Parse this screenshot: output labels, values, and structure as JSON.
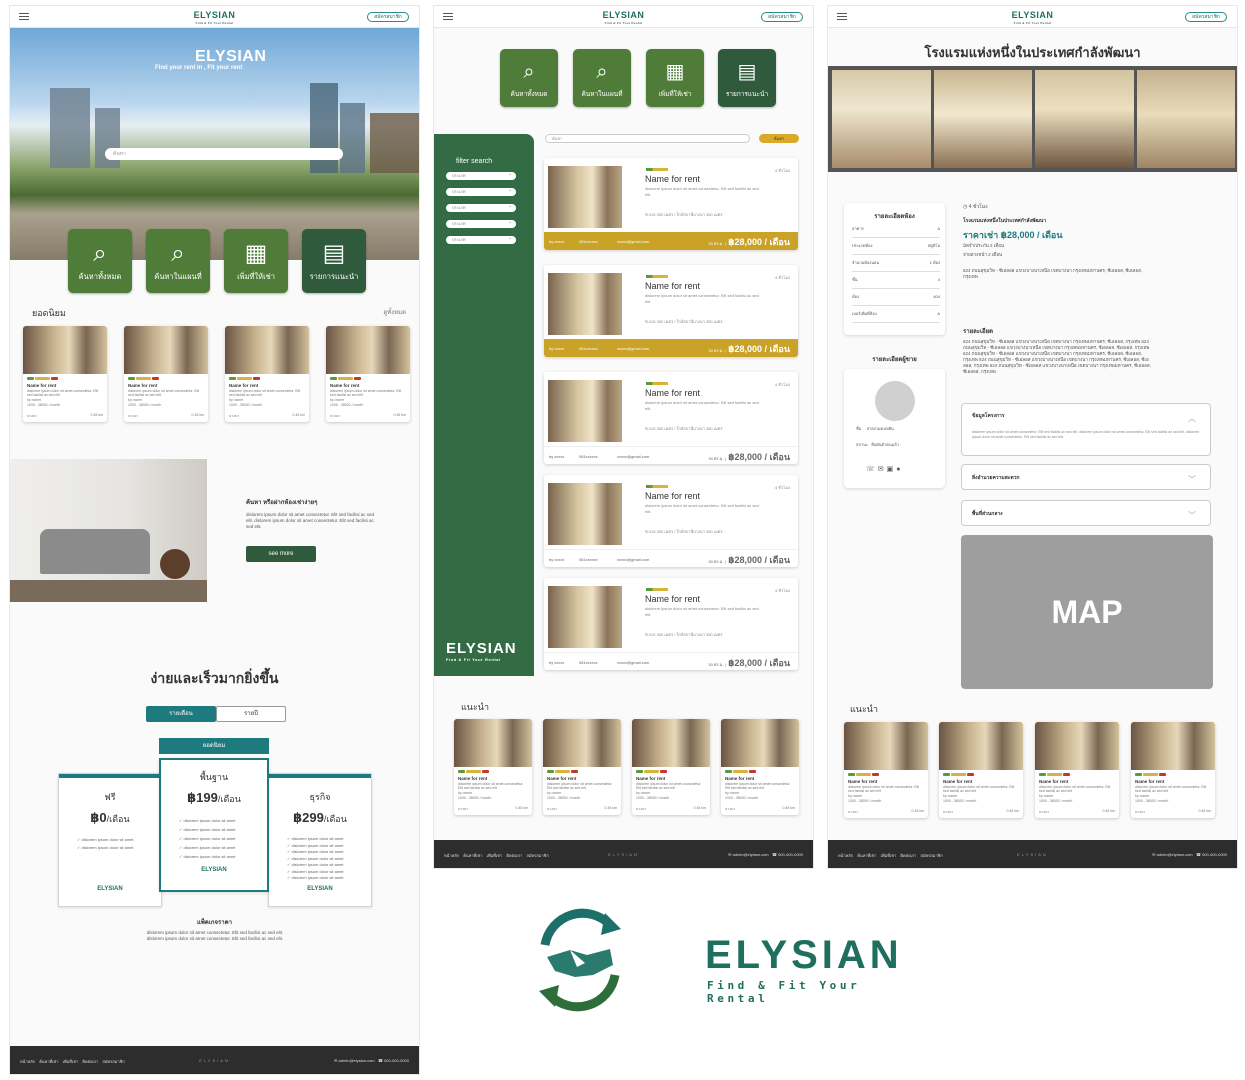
{
  "header": {
    "brand": "ELYSIAN",
    "brand_sub": "Find & Fit Your Rental",
    "register": "สมัครสมาชิก"
  },
  "home": {
    "hero_title": "ELYSIAN",
    "hero_sub": "Find your rent in , Fit your rent",
    "search_placeholder": "ค้นหา",
    "buttons": [
      {
        "label": "ค้นหาทั้งหมด",
        "icon": "search-building-icon"
      },
      {
        "label": "ค้นหาในแผนที่",
        "icon": "search-map-icon"
      },
      {
        "label": "เพิ่มที่ให้เช่า",
        "icon": "add-building-icon"
      },
      {
        "label": "รายการแนะนำ",
        "icon": "clipboard-icon"
      }
    ],
    "popular_title": "ยอดนิยม",
    "see_all": "ดูทั้งหมด",
    "promo_title": "ค้นหา หรือฝากห้องเช่าง่ายๆ",
    "promo_text": "dislorem ipsum dolor sit amet consectetur. Elit sed facilisi ac sed elit. dislorem ipsum dolor sit amet consectetur. Elit sed facilisi ac sed elit.",
    "see_more": "see more",
    "pricing_title": "ง่ายและเร็วมากยิ่งขึ้น",
    "toggle_month": "รายเดือน",
    "toggle_year": "รายปี",
    "popular_badge": "ยอดนิยม",
    "plans": [
      {
        "name": "ฟรี",
        "price": "฿0",
        "unit": "/เดือน",
        "features": [
          "dislorem ipsum dolor sit amet",
          "dislorem ipsum dolor sit amet"
        ]
      },
      {
        "name": "พื้นฐาน",
        "price": "฿199",
        "unit": "/เดือน",
        "features": [
          "dislorem ipsum dolor sit amet",
          "dislorem ipsum dolor sit amet",
          "dislorem ipsum dolor sit amet",
          "dislorem ipsum dolor sit amet",
          "dislorem ipsum dolor sit amet"
        ]
      },
      {
        "name": "ธุรกิจ",
        "price": "฿299",
        "unit": "/เดือน",
        "features": [
          "dislorem ipsum dolor sit amet",
          "dislorem ipsum dolor sit amet",
          "dislorem ipsum dolor sit amet",
          "dislorem ipsum dolor sit amet",
          "dislorem ipsum dolor sit amet",
          "dislorem ipsum dolor sit amet",
          "dislorem ipsum dolor sit amet"
        ]
      }
    ],
    "plan_logo": "ELYSIAN",
    "package_title": "แพ็คเกจราคา",
    "package_text": "dislorem ipsum dolor sit amet consectetur. Elit sed facilisi ac sed elit. dislorem ipsum dolor sit amet consectetur. Elit sed facilisi ac sed elit."
  },
  "mini_card": {
    "name": "Name for rent",
    "desc": "dislorem ipsum dolor sit amet consectetur. Elit sed facilisi ac sed elit",
    "by": "by owner",
    "price": "1000 - 38000 / month",
    "loc": "บางนา",
    "dist": "0.45 km"
  },
  "list": {
    "filter_title": "filter search",
    "filters": [
      "ประเภท",
      "ประเภท",
      "ประเภท",
      "ประเภท",
      "ประเภท"
    ],
    "search_placeholder": "ค้นหา",
    "search_btn": "ค้นหา",
    "brand": "ELYSIAN",
    "brand_sub": "Find & Fit Your Rental",
    "card": {
      "name": "Name for rent",
      "desc": "dislorem ipsum dolor sit amet consectetur. Elit sed facilisi ac sed elit.",
      "loc": "ซ.015 300 เมตร / ใกล้สถานีบางนา 350 เมตร",
      "time": "4 ชั่วโมง",
      "owner": "by xxxxx",
      "phone": "081xxxxxx",
      "email": "xxxxx@gmail.com",
      "price_note": "30 ตร.ม. |",
      "price": "฿28,000 / เดือน"
    },
    "recommend_title": "แนะนำ"
  },
  "detail": {
    "title": "โรงแรมแห่งหนึ่งในประเทศกำลังพัฒนา",
    "time": "4 ชั่วโมง",
    "name": "โรงแรมแห่งหนึ่งในประเทศกำลังพัฒนา",
    "price": "ราคาเช่า ฿28,000 / เดือน",
    "deposit": "มัดจำ/ประกัน  2 เดือน",
    "advance": "จ่ายล่วงหน้า  2 เดือน",
    "address": "624 ถนนสุขุมวิท - ซีเอลอส แขวงบางนาเหนือ เขตบางนา กรุงเทพมหานคร, ซีเอลอส, ซีเอลอส, กรุงเทพ",
    "room_title": "รายละเอียดห้อง",
    "rows": [
      [
        "อาคาร",
        "A"
      ],
      [
        "ประเภทห้อง",
        "สตูดิโอ"
      ],
      [
        "จำนวนห้องนอน",
        "1 ห้อง"
      ],
      [
        "ชั้น",
        "4"
      ],
      [
        "ห้อง",
        "404"
      ],
      [
        "เบอร์เพิ่มที่ห้อง",
        "A"
      ]
    ],
    "owner_title": "รายละเอียดผู้ขาย",
    "owner_name_label": "ชื่อ",
    "owner_name": "สวยงามคนขยัน",
    "owner_status_label": "สถานะ",
    "owner_status": "ยืนยันตัวตนแล้ว",
    "desc_title": "รายละเอียด",
    "desc": "624 ถนนสุขุมวิท - ซีเอลอส แขวงบางนาเหนือ เขตบางนา กรุงเทพมหานคร, ซีเอลอส, กรุงเทพ 624 ถนนสุขุมวิท - ซีเอลอส แขวงบางนาเหนือ เขตบางนา กรุงเทพมหานคร, ซีเอลอส, ซีเอลอส, กรุงเทพ 624 ถนนสุขุมวิท - ซีเอลอส แขวงบางนาเหนือ เขตบางนา กรุงเทพมหานคร, ซีเอลอส, ซีเอลอส, กรุงเทพ 624 ถนนสุขุมวิท - ซีเอลอส แขวงบางนาเหนือ เขตบางนา กรุงเทพมหานคร, ซีเอลอส, ซีเอลอส, กรุงเทพ 624 ถนนสุขุมวิท - ซีเอลอส แขวงบางนาเหนือ เขตบางนา กรุงเทพมหานคร, ซีเอลอส, ซีเอลอส, กรุงเทพ",
    "acc1": "ข้อมูลโครงการ",
    "acc1_text": "dislorem ipsum dolor sit amet consectetur. Elit sed facilisi ac sed elit. dislorem ipsum dolor sit amet consectetur. Elit sed facilisi ac sed elit. dislorem ipsum dolor sit amet consectetur. Elit sed facilisi ac sed elit.",
    "acc2": "สิ่งอำนวยความสะดวก",
    "acc3": "พื้นที่ส่วนกลาง",
    "map": "MAP",
    "recommend_title": "แนะนำ"
  },
  "footer": {
    "links": "หน้าหลัก ค้นหาที่เช่า เพิ่มที่เช่า ติดต่อเรา สมัครสมาชิก",
    "brand": "ELYSIAN",
    "email": "✉ admin@elysian.com",
    "phone": "☎ 000-000-0000"
  },
  "logo": {
    "name": "ELYSIAN",
    "tagline": "Find & Fit Your Rental",
    "icon": "handshake-arrows-icon"
  },
  "colors": {
    "green": "#4f7d39",
    "dark_green": "#2f5a3c",
    "teal": "#1d7a7f",
    "gold": "#c9a227",
    "footer": "#2d2d2d"
  }
}
